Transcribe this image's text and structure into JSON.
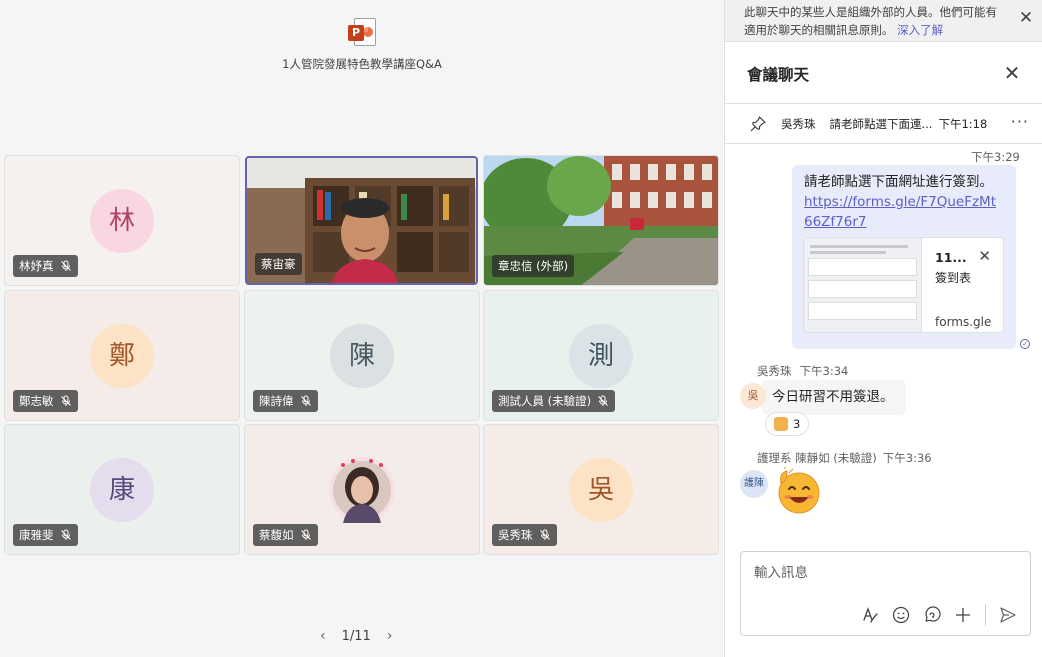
{
  "stage": {
    "share_name": "1人管院發展特色教學講座Q&A",
    "participants": [
      {
        "name": "林妤真",
        "initial": "林",
        "bg": "#f9d7e2",
        "fg": "#b04363",
        "tile_bg": "#f4f1ef",
        "muted": true,
        "video": false
      },
      {
        "name": "蔡宙豪",
        "video": true,
        "speaking": true,
        "muted": false
      },
      {
        "name": "章忠信 (外部)",
        "video": true,
        "muted": false
      },
      {
        "name": "鄭志敏",
        "initial": "鄭",
        "bg": "#fde3c6",
        "fg": "#a0542a",
        "tile_bg": "#f5ebe8",
        "muted": true,
        "video": false
      },
      {
        "name": "陳詩偉",
        "initial": "陳",
        "bg": "#dbe0e3",
        "fg": "#4a5a63",
        "tile_bg": "#eef2ef",
        "muted": true,
        "video": false
      },
      {
        "name": "測試人員 (未驗證)",
        "initial": "測",
        "bg": "#dbe3e6",
        "fg": "#3f5560",
        "tile_bg": "#e9f1ef",
        "muted": true,
        "video": false
      },
      {
        "name": "康雅斐",
        "initial": "康",
        "bg": "#e3ddee",
        "fg": "#574a7a",
        "tile_bg": "#ebf0ed",
        "muted": true,
        "video": false
      },
      {
        "name": "蔡馥如",
        "photo": true,
        "tile_bg": "#f4ece8",
        "muted": true,
        "video": false
      },
      {
        "name": "吳秀珠",
        "initial": "吳",
        "bg": "#fde3c6",
        "fg": "#a0542a",
        "tile_bg": "#f5ece7",
        "muted": true,
        "video": false
      }
    ],
    "pager": "1/11"
  },
  "chat": {
    "banner_text": "此聊天中的某些人是組織外部的人員。他們可能有適用於聊天的相關訊息原則。",
    "banner_link": "深入了解",
    "title": "會議聊天",
    "pinned": {
      "author": "吳秀珠",
      "text": "請老師點選下面連...",
      "time": "下午1:18"
    },
    "msg1": {
      "time": "下午3:29",
      "text": "請老師點選下面網址進行簽到。",
      "link": "https://forms.gle/F7QueFzMt66Zf76r7",
      "card_title": "11...",
      "card_sub": "簽到表",
      "card_domain": "forms.gle"
    },
    "msg2": {
      "author": "吳秀珠",
      "time": "下午3:34",
      "avatar": "吳",
      "text": "今日研習不用簽退。",
      "reaction_count": "3"
    },
    "msg3": {
      "author": "護理系 陳靜如 (未驗證)",
      "time": "下午3:36",
      "avatar": "護陳"
    },
    "compose_placeholder": "輸入訊息"
  }
}
